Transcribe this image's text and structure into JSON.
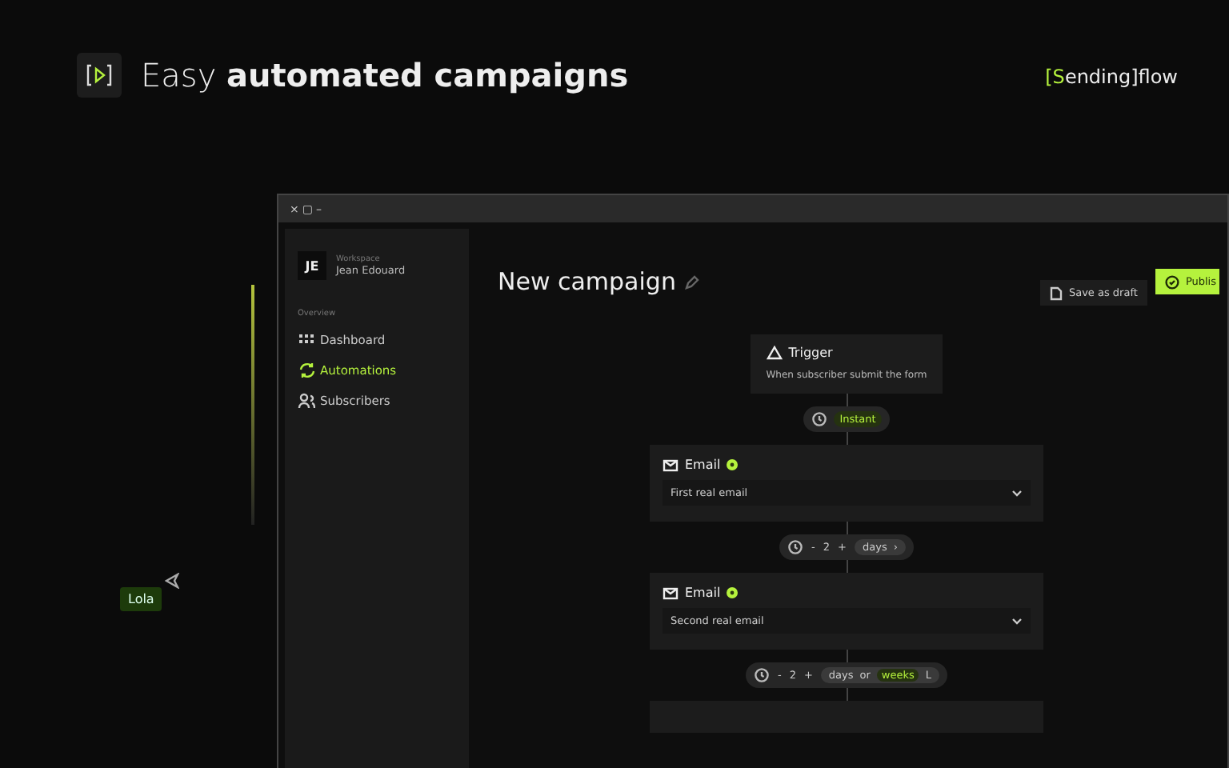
{
  "header": {
    "headline": "Easy **automated campaigns**",
    "brand_bracket": "[Sending]",
    "brand_word": "flow"
  },
  "cursor_label": "Lola",
  "window": {
    "controls": [
      "×",
      "▢",
      "–"
    ]
  },
  "sidebar": {
    "workspace_label": "Workspace",
    "avatar": "JE",
    "user": "Jean Edouard",
    "section": "Overview",
    "items": [
      {
        "label": "Dashboard",
        "selected": false
      },
      {
        "label": "Automations",
        "selected": true
      },
      {
        "label": "Subscribers",
        "selected": false
      }
    ]
  },
  "page": {
    "title": "New campaign",
    "buttons": [
      {
        "label": "Save as draft",
        "kind": "secondary"
      },
      {
        "label": "Publis",
        "kind": "primary"
      }
    ]
  },
  "flow": [
    {
      "kind": "trigger",
      "title": "Trigger",
      "text": "When subscriber submit the form"
    },
    {
      "kind": "instant",
      "label": "Instant"
    },
    {
      "kind": "email",
      "title": "Email",
      "value": "First real email"
    },
    {
      "kind": "delay",
      "minus": "-",
      "count": "2",
      "plus": "+",
      "units": [
        {
          "label": "days",
          "selected": false
        }
      ],
      "chevron": "›"
    },
    {
      "kind": "email",
      "title": "Email",
      "value": "Second real email"
    },
    {
      "kind": "delay",
      "minus": "-",
      "count": "2",
      "plus": "+",
      "units": [
        {
          "label": "days",
          "selected": false
        },
        {
          "label": "or",
          "selected": false
        },
        {
          "label": "weeks",
          "selected": true
        }
      ],
      "chevron": "L"
    },
    {
      "kind": "stub"
    }
  ]
}
